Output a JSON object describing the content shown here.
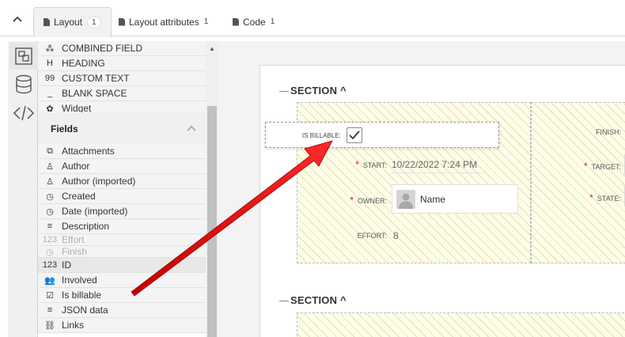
{
  "tabs": [
    {
      "label": "Layout",
      "count": "1"
    },
    {
      "label": "Layout attributes",
      "count": "1"
    },
    {
      "label": "Code",
      "count": "1"
    }
  ],
  "palette": {
    "elements": [
      {
        "label": "COMBINED FIELD",
        "icon": "⁂"
      },
      {
        "label": "HEADING",
        "icon": "H"
      },
      {
        "label": "CUSTOM TEXT",
        "icon": "99"
      },
      {
        "label": "BLANK SPACE",
        "icon": "_"
      },
      {
        "label": "Widget",
        "icon": "✿"
      }
    ],
    "fields_header": "Fields",
    "fields": [
      {
        "label": "Attachments",
        "icon": "⧉"
      },
      {
        "label": "Author",
        "icon": "♙"
      },
      {
        "label": "Author (imported)",
        "icon": "♙"
      },
      {
        "label": "Created",
        "icon": "◷"
      },
      {
        "label": "Date (imported)",
        "icon": "◷"
      },
      {
        "label": "Description",
        "icon": "≡"
      },
      {
        "label": "Effort",
        "icon": "123"
      },
      {
        "label": "Finish",
        "icon": "◷"
      },
      {
        "label": "ID",
        "icon": "123"
      },
      {
        "label": "Involved",
        "icon": "👥"
      },
      {
        "label": "Is billable",
        "icon": "☑"
      },
      {
        "label": "JSON data",
        "icon": "≡"
      },
      {
        "label": "Links",
        "icon": "⛓"
      }
    ]
  },
  "canvas": {
    "section1": {
      "title": "SECTION ^",
      "fields": {
        "start_label": "START:",
        "start_value": "10/22/2022 7:24 PM",
        "owner_label": "OWNER:",
        "owner_value": "Name",
        "effort_label": "EFFORT:",
        "effort_value": "8",
        "finish_label": "FINISH:",
        "target_label": "TARGET:",
        "state_label": "STATE:"
      }
    },
    "section2": {
      "title": "SECTION ^"
    }
  },
  "drag_ghost": {
    "label": "IS BILLABLE:",
    "checked": true
  },
  "colors": {
    "required": "#e02020",
    "arrow": "#e01818",
    "hatch": "#fdfde8"
  }
}
